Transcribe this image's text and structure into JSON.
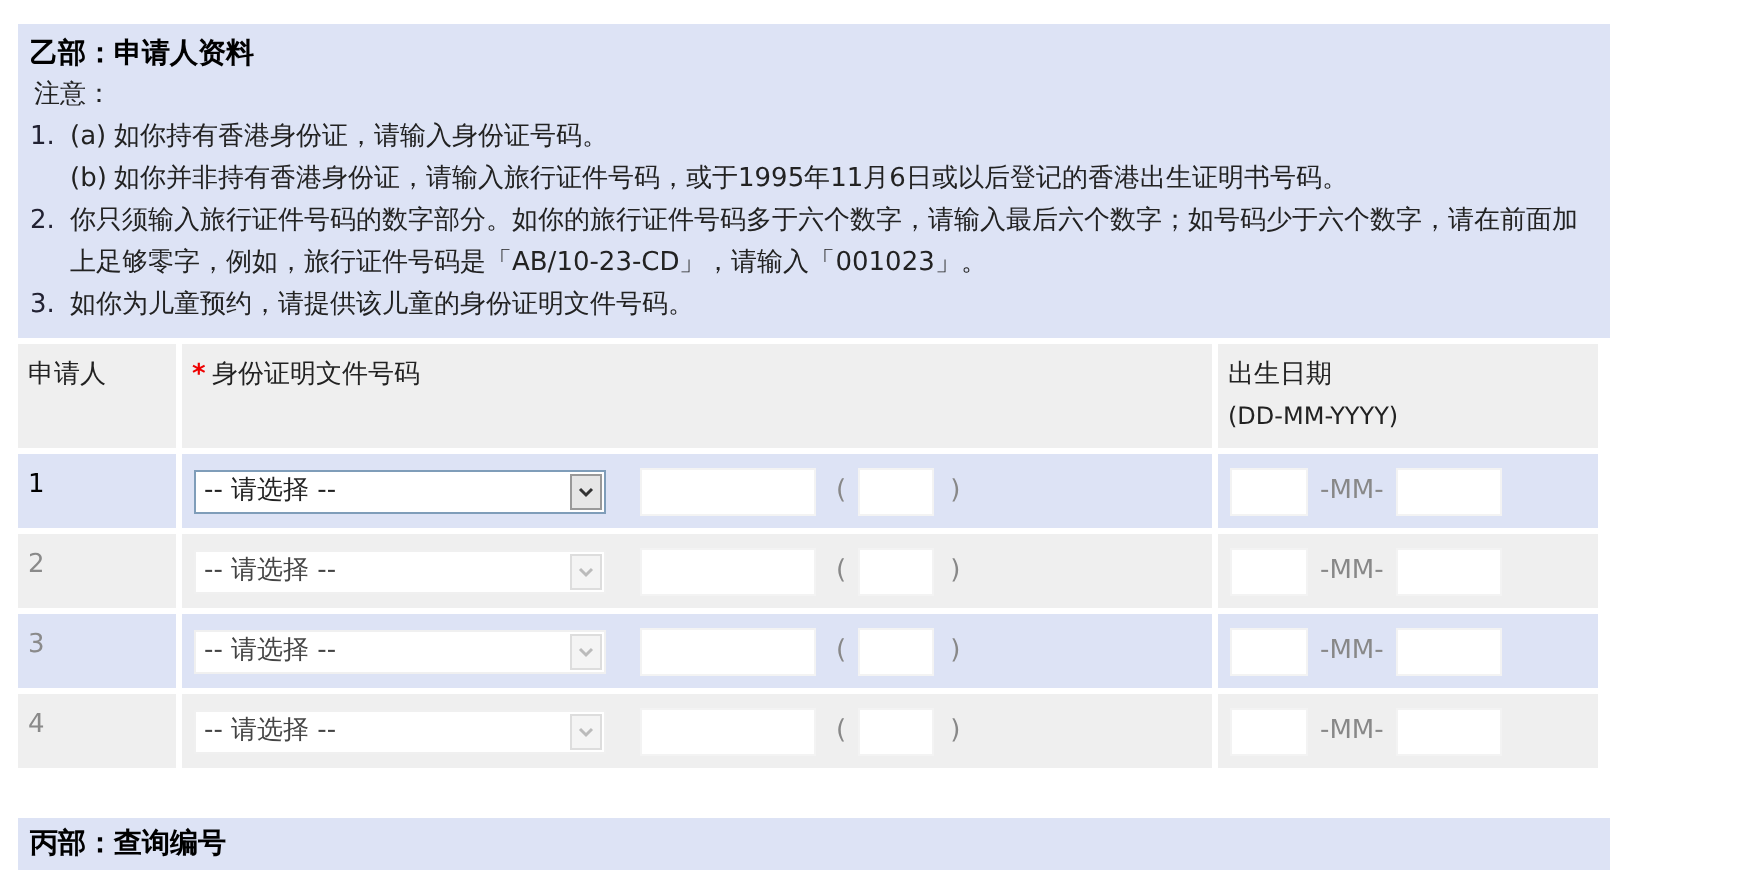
{
  "section_b": {
    "title": "乙部：申请人资料",
    "note_label": "注意：",
    "notes": [
      {
        "marker": "1.",
        "parts": [
          {
            "marker": "(a)",
            "text": "如你持有香港身份证，请输入身份证号码。"
          },
          {
            "marker": "(b)",
            "text": "如你并非持有香港身份证，请输入旅行证件号码，或于1995年11月6日或以后登记的香港出生证明书号码。"
          }
        ]
      },
      {
        "marker": "2.",
        "text": "你只须输入旅行证件号码的数字部分。如你的旅行证件号码多于六个数字，请输入最后六个数字；如号码少于六个数字，请在前面加上足够零字，例如，旅行证件号码是「AB/10-23-CD」，请输入「001023」。"
      },
      {
        "marker": "3.",
        "text": "如你为儿童预约，请提供该儿童的身份证明文件号码。"
      }
    ]
  },
  "table": {
    "columns": [
      {
        "label": "申请人"
      },
      {
        "label": "身份证明文件号码",
        "required": true,
        "required_mark": "*"
      },
      {
        "label": "出生日期",
        "hint": "(DD-MM-YYYY)"
      }
    ],
    "rows": [
      {
        "number": "1",
        "disabled": false,
        "select": "-- 请选择 --",
        "open_paren": "(",
        "close_paren": ")",
        "date_separator": "-MM-"
      },
      {
        "number": "2",
        "disabled": true,
        "select": "-- 请选择 --",
        "open_paren": "(",
        "close_paren": ")",
        "date_separator": "-MM-"
      },
      {
        "number": "3",
        "disabled": true,
        "select": "-- 请选择 --",
        "open_paren": "(",
        "close_paren": ")",
        "date_separator": "-MM-"
      },
      {
        "number": "4",
        "disabled": true,
        "select": "-- 请选择 --",
        "open_paren": "(",
        "close_paren": ")",
        "date_separator": "-MM-"
      }
    ]
  },
  "section_c": {
    "title": "丙部：查询编号"
  }
}
